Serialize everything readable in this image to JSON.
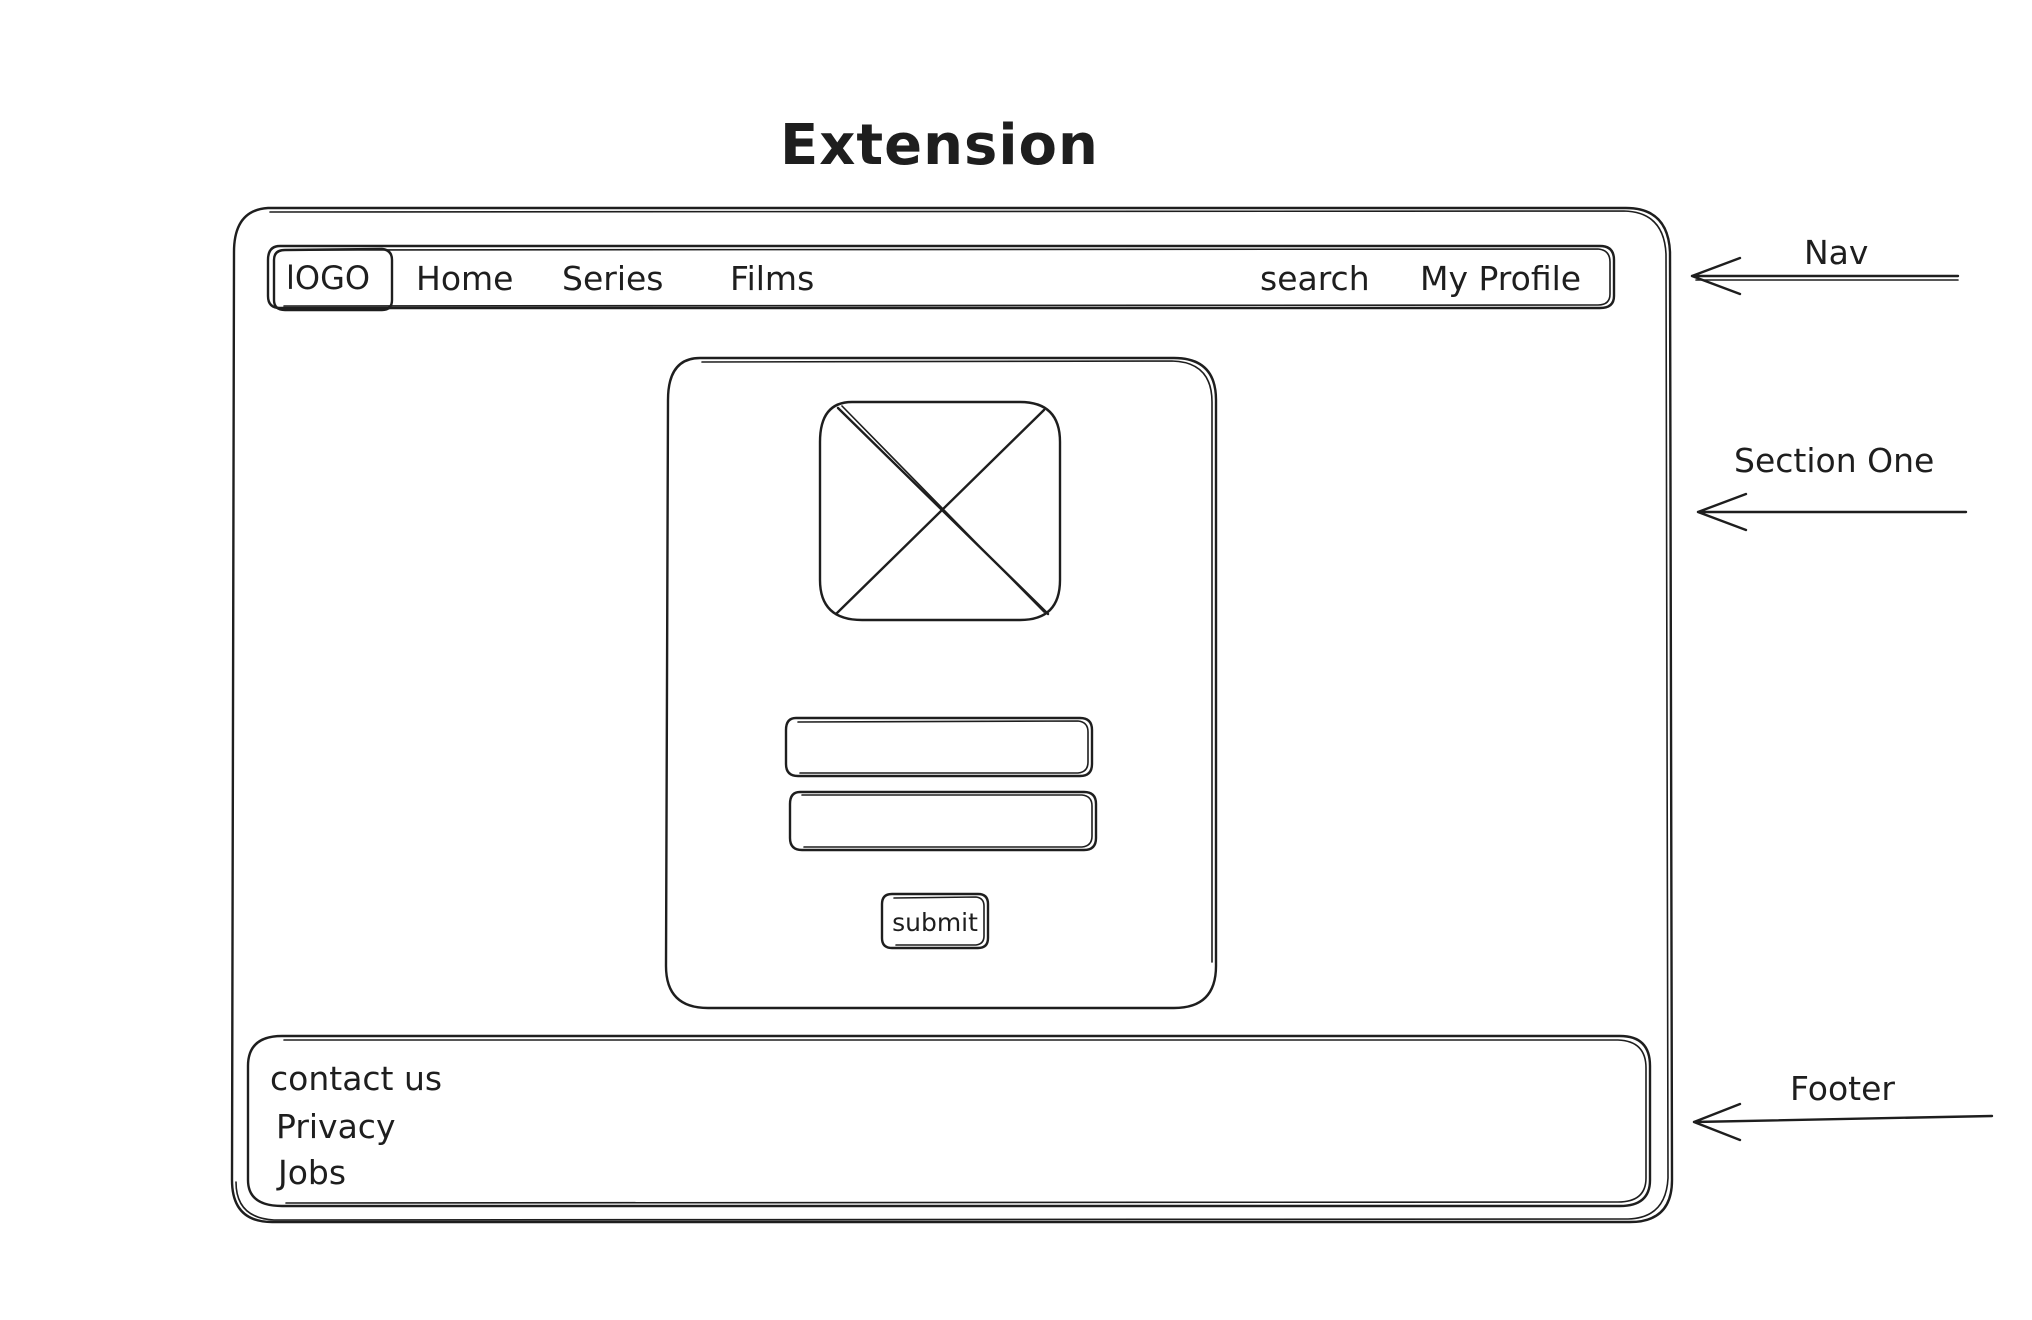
{
  "title": "Extension",
  "nav": {
    "logo": "lOGO",
    "items": [
      "Home",
      "Series",
      "Films"
    ],
    "search": "search",
    "profile": "My Profile"
  },
  "login_card": {
    "image_placeholder_icon": "image-placeholder-x-icon",
    "fields": [
      {
        "value": "",
        "placeholder": ""
      },
      {
        "value": "",
        "placeholder": ""
      }
    ],
    "submit_label": "submit"
  },
  "footer": {
    "links": [
      "contact us",
      "Privacy",
      "Jobs"
    ]
  },
  "annotations": {
    "nav": "Nav",
    "section_one": "Section One",
    "footer": "Footer"
  }
}
